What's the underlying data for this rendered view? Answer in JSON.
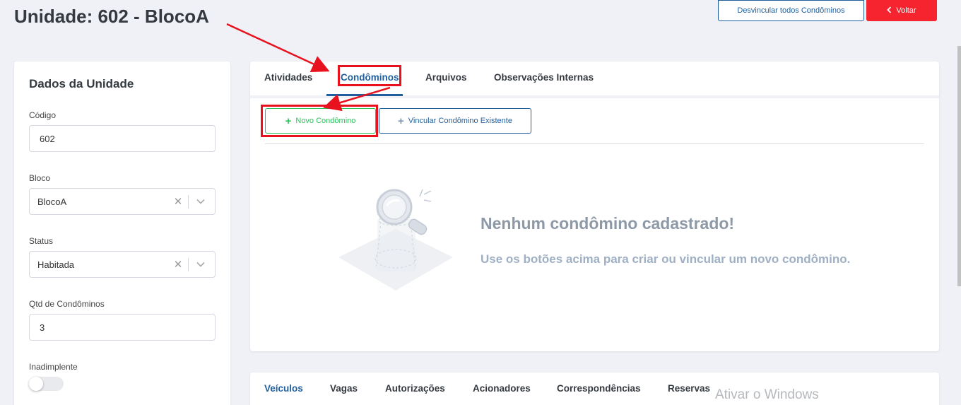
{
  "page": {
    "title": "Unidade: 602 - BlocoA"
  },
  "header_actions": {
    "unlink_label": "Desvincular todos Condôminos",
    "back_label": "Voltar"
  },
  "unit_panel": {
    "title": "Dados da Unidade",
    "codigo": {
      "label": "Código",
      "value": "602"
    },
    "bloco": {
      "label": "Bloco",
      "value": "BlocoA"
    },
    "status": {
      "label": "Status",
      "value": "Habitada"
    },
    "qtd": {
      "label": "Qtd de Condôminos",
      "value": "3"
    },
    "inadimplente": {
      "label": "Inadimplente",
      "checked": false
    }
  },
  "tabs": [
    "Atividades",
    "Condôminos",
    "Arquivos",
    "Observações Internas"
  ],
  "active_tab": "Condôminos",
  "actions": {
    "new_label": "Novo Condômino",
    "link_label": "Vincular Condômino Existente"
  },
  "empty_state": {
    "title": "Nenhum condômino cadastrado!",
    "subtitle": "Use os botões acima para criar ou vincular um novo condômino."
  },
  "bottom_tabs": [
    "Veículos",
    "Vagas",
    "Autorizações",
    "Acionadores",
    "Correspondências",
    "Reservas"
  ],
  "bottom_active_tab": "Veículos",
  "watermark": "Ativar o Windows",
  "colors": {
    "primary": "#1f5f9e",
    "danger": "#f5242f",
    "success": "#2fbf5b",
    "annotation": "#e8121e"
  }
}
